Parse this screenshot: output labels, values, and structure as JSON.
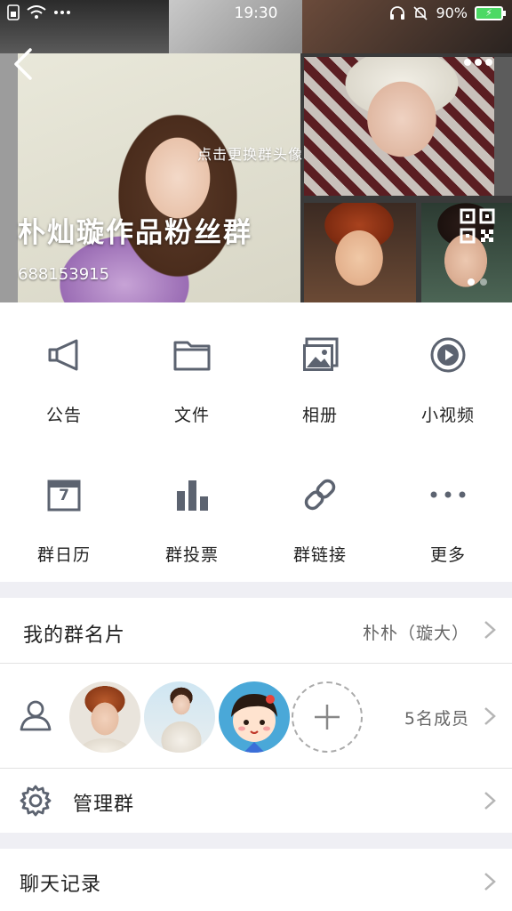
{
  "status_bar": {
    "time": "19:30",
    "battery": "90%"
  },
  "header": {
    "avatar_hint": "点击更换群头像",
    "group_name": "朴灿璇作品粉丝群",
    "group_id": "688153915"
  },
  "grid": {
    "items": [
      {
        "label": "公告",
        "icon": "megaphone-icon"
      },
      {
        "label": "文件",
        "icon": "folder-icon"
      },
      {
        "label": "相册",
        "icon": "album-icon"
      },
      {
        "label": "小视频",
        "icon": "video-icon"
      },
      {
        "label": "群日历",
        "icon": "calendar-icon"
      },
      {
        "label": "群投票",
        "icon": "poll-icon"
      },
      {
        "label": "群链接",
        "icon": "link-icon"
      },
      {
        "label": "更多",
        "icon": "more-icon"
      }
    ],
    "calendar_day": "7"
  },
  "card": {
    "title": "我的群名片",
    "value": "朴朴（璇大）"
  },
  "members": {
    "count": "5名成员"
  },
  "manage": {
    "title": "管理群"
  },
  "history": {
    "title": "聊天记录"
  },
  "colors": {
    "icon_gray": "#5c6370",
    "accent_green": "#4cd964"
  }
}
